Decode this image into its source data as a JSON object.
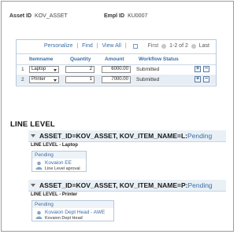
{
  "header": {
    "asset_label": "Asset ID",
    "asset_value": "KOV_ASSET",
    "empl_label": "Empl ID",
    "empl_value": "KU0007"
  },
  "grid": {
    "personalize": "Personalize",
    "find": "Find",
    "view_all": "View All",
    "first": "First",
    "range": "1-2 of 2",
    "last": "Last",
    "columns": [
      "Itemname",
      "Quantity",
      "Amount",
      "Workflow Status"
    ],
    "rows": [
      {
        "num": "1",
        "item": "Laptop",
        "qty": "2",
        "amount": "6000.00",
        "status": "Submitted"
      },
      {
        "num": "2",
        "item": "Printer",
        "qty": "1",
        "amount": "7000.00",
        "status": "Submitted"
      }
    ],
    "add_glyph": "+",
    "remove_glyph": "−"
  },
  "line_level": {
    "title": "LINE LEVEL",
    "panels": [
      {
        "header": "ASSET_ID=KOV_ASSET, KOV_ITEM_NAME=L:",
        "status": "Pending",
        "subtitle": "LINE LEVEL - Laptop",
        "card_title": "Pending",
        "approver": "Kovaion EE",
        "role": "Line Level aproval"
      },
      {
        "header": "ASSET_ID=KOV_ASSET, KOV_ITEM_NAME=P:",
        "status": "Pending",
        "subtitle": "LINE LEVEL - Printer",
        "card_title": "Pending",
        "approver": "Kovaion Dept Head - AWE",
        "role": "Kovaion Dept Head"
      }
    ]
  },
  "colors": {
    "link": "#3b6ea5",
    "grid_border": "#b7c9da",
    "alt_row": "#e7edf4"
  }
}
